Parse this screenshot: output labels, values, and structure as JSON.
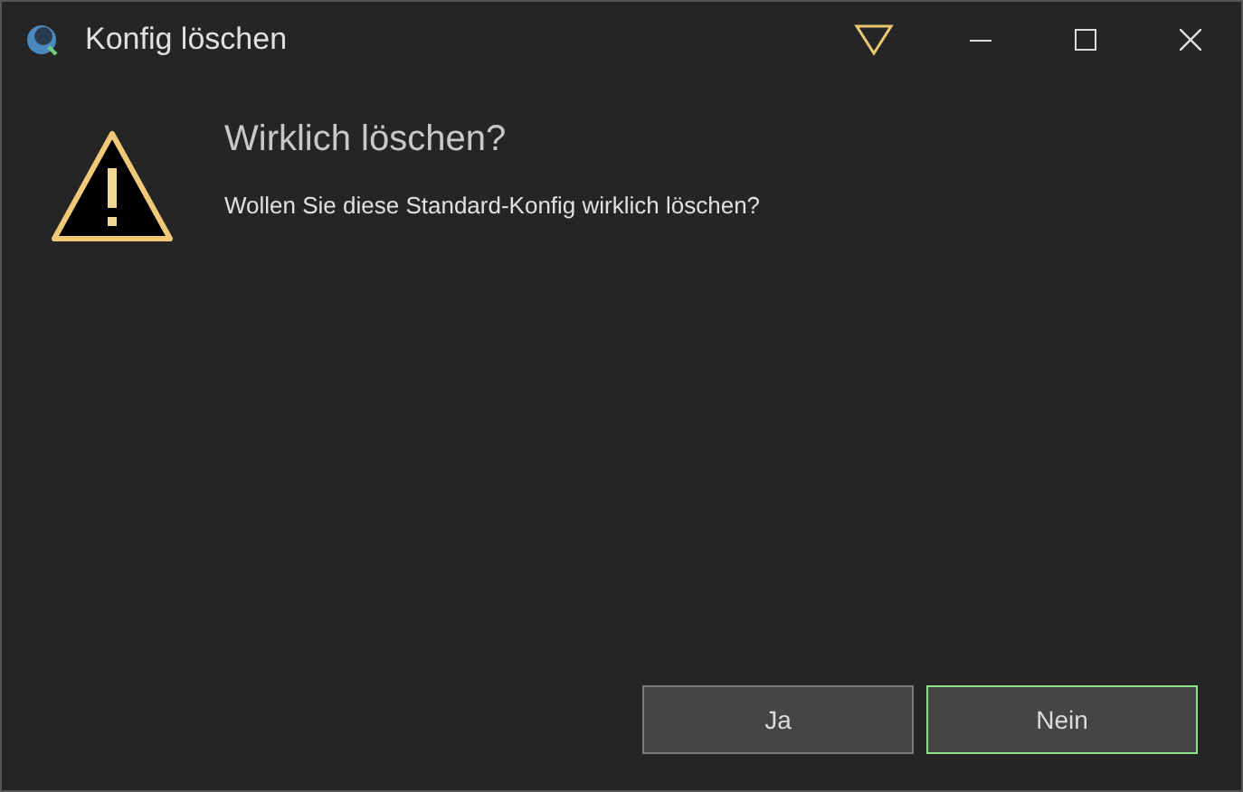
{
  "window": {
    "title": "Konfig löschen"
  },
  "dialog": {
    "heading": "Wirklich löschen?",
    "message": "Wollen Sie diese Standard-Konfig wirklich löschen?"
  },
  "buttons": [
    {
      "label": "Ja",
      "focused": false
    },
    {
      "label": "Nein",
      "focused": true
    }
  ]
}
